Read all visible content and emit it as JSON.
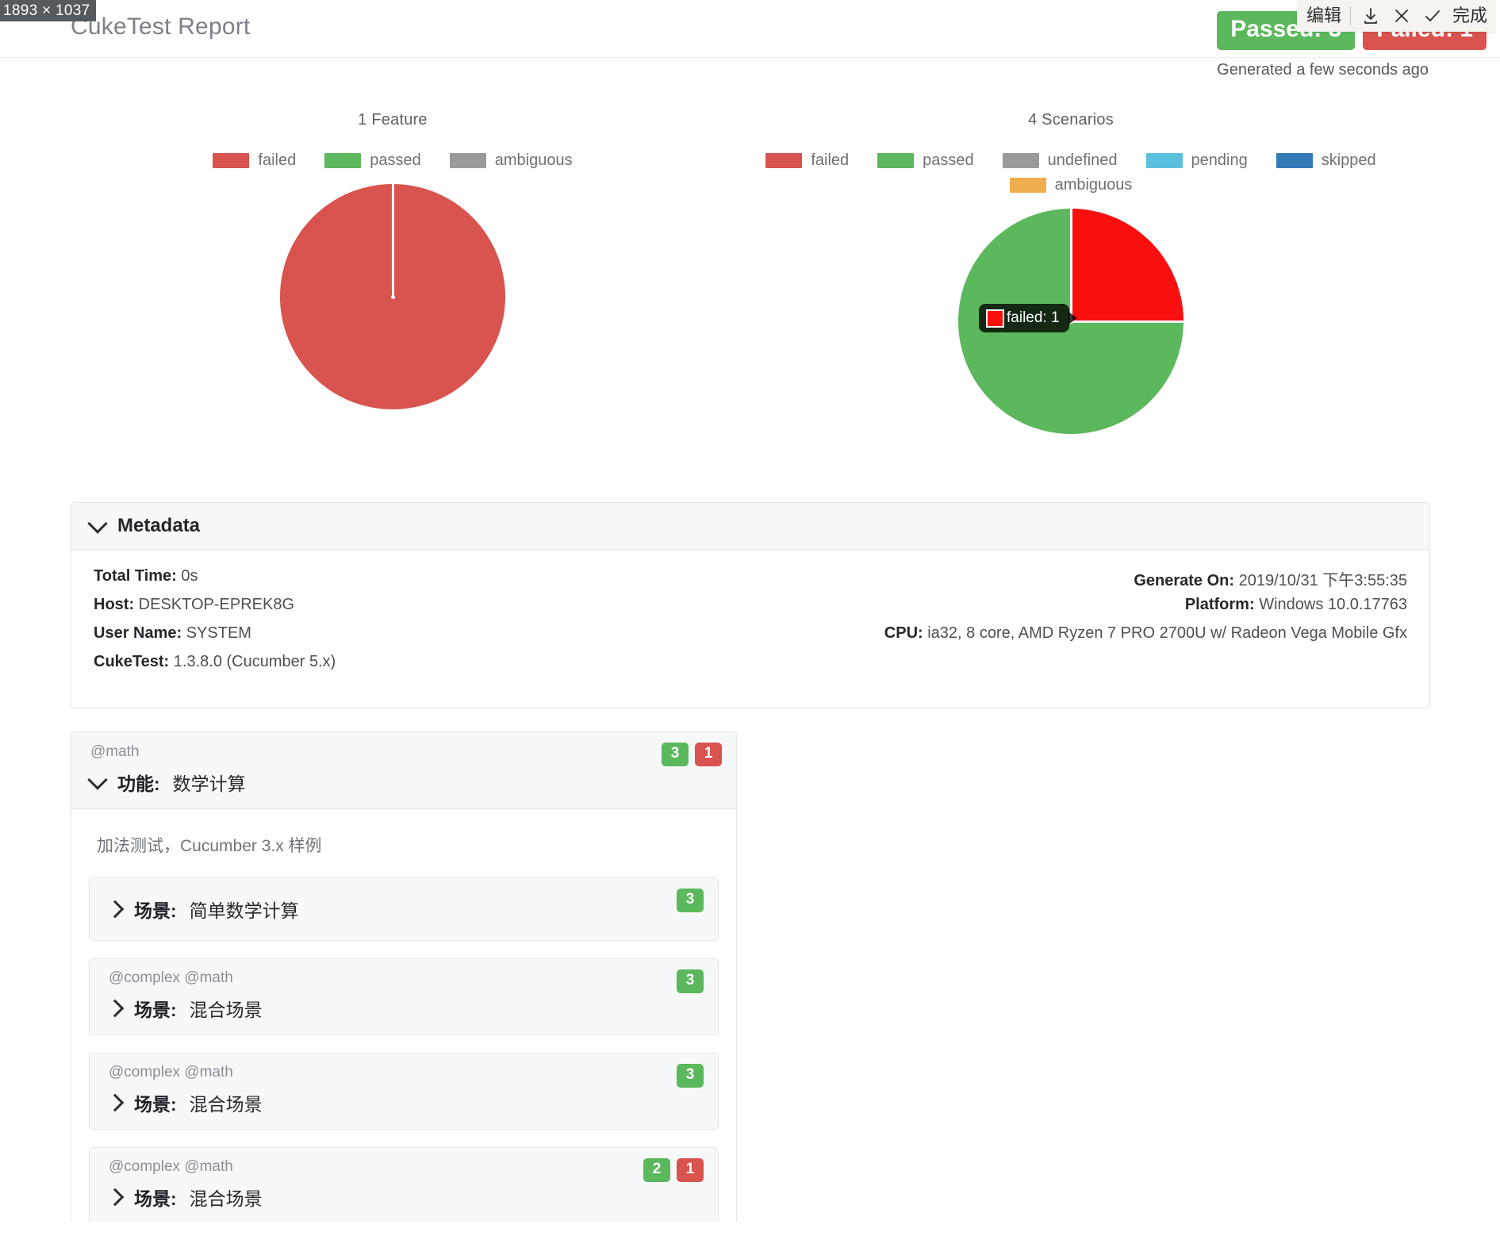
{
  "os_overlay": {
    "size_badge": "1893 × 1037",
    "toolbar": {
      "edit_label": "编辑",
      "done_label": "完成",
      "icons": [
        "download-icon",
        "close-icon",
        "check-icon"
      ]
    }
  },
  "header": {
    "title": "CukeTest Report",
    "passed_badge": "Passed: 3",
    "failed_badge": "Failed: 1",
    "generated": "Generated a few seconds ago",
    "passed_color": "#5cb85c",
    "failed_color": "#d9534f"
  },
  "chart_data": [
    {
      "type": "pie",
      "title": "1 Feature",
      "categories": [
        "failed",
        "passed",
        "ambiguous"
      ],
      "values": [
        1,
        0,
        0
      ],
      "colors": [
        "#d9534f",
        "#5cb85c",
        "#9a9a9a"
      ],
      "legend_position": "top",
      "labels": [
        "failed",
        "passed",
        "ambiguous"
      ]
    },
    {
      "type": "pie",
      "title": "4 Scenarios",
      "categories": [
        "failed",
        "passed",
        "undefined",
        "pending",
        "skipped",
        "ambiguous"
      ],
      "values": [
        1,
        3,
        0,
        0,
        0,
        0
      ],
      "colors": [
        "#d9534f",
        "#5cb85c",
        "#9a9a9a",
        "#5bc0de",
        "#337ab7",
        "#f0ad4e"
      ],
      "legend_position": "top",
      "tooltip": {
        "label": "failed: 1",
        "swatch_color": "#fa0f0f"
      }
    }
  ],
  "metadata": {
    "header": "Metadata",
    "rows": [
      {
        "left_key": "Total Time:",
        "left_value": "0s",
        "right_key": "Generate On:",
        "right_value": "2019/10/31 下午3:55:35"
      },
      {
        "left_key": "Host:",
        "left_value": "DESKTOP-EPREK8G",
        "right_key": "Platform:",
        "right_value": "Windows 10.0.17763"
      },
      {
        "left_key": "User Name:",
        "left_value": "SYSTEM",
        "right_key": "CPU:",
        "right_value": "ia32, 8 core, AMD Ryzen 7 PRO 2700U w/ Radeon Vega Mobile Gfx"
      },
      {
        "left_key": "CukeTest:",
        "left_value": "1.3.8.0 (Cucumber 5.x)",
        "right_key": "",
        "right_value": ""
      }
    ]
  },
  "feature": {
    "tags": "@math",
    "keyword": "功能:",
    "name": "数学计算",
    "passed_count": "3",
    "failed_count": "1",
    "description": "加法测试，Cucumber 3.x 样例",
    "scenarios": [
      {
        "tags": "",
        "keyword": "场景:",
        "name": "简单数学计算",
        "passed_count": "3",
        "failed_count": ""
      },
      {
        "tags": "@complex @math",
        "keyword": "场景:",
        "name": "混合场景",
        "passed_count": "3",
        "failed_count": ""
      },
      {
        "tags": "@complex @math",
        "keyword": "场景:",
        "name": "混合场景",
        "passed_count": "3",
        "failed_count": ""
      },
      {
        "tags": "@complex @math",
        "keyword": "场景:",
        "name": "混合场景",
        "passed_count": "2",
        "failed_count": "1"
      }
    ]
  }
}
